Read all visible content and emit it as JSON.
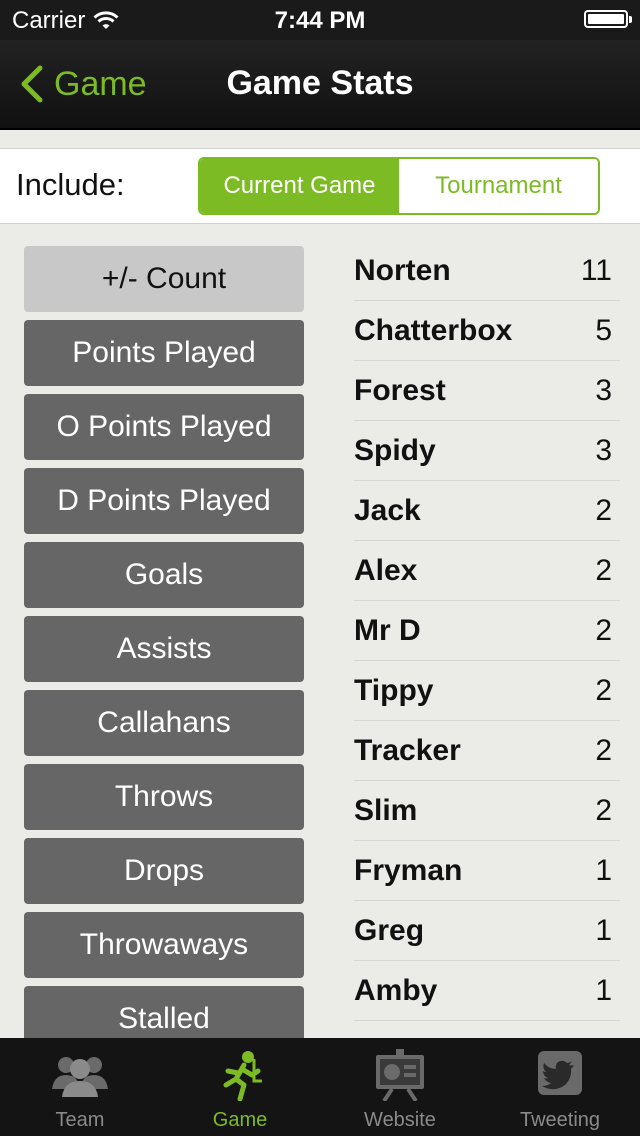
{
  "status": {
    "carrier": "Carrier",
    "time": "7:44 PM"
  },
  "nav": {
    "back_label": "Game",
    "title": "Game Stats"
  },
  "include": {
    "label": "Include:",
    "options": [
      "Current Game",
      "Tournament"
    ],
    "selected": "Current Game"
  },
  "stat_buttons": [
    "+/- Count",
    "Points Played",
    "O Points Played",
    "D Points Played",
    "Goals",
    "Assists",
    "Callahans",
    "Throws",
    "Drops",
    "Throwaways",
    "Stalled"
  ],
  "selected_stat": "+/- Count",
  "players": [
    {
      "name": "Norten",
      "count": "11"
    },
    {
      "name": "Chatterbox",
      "count": "5"
    },
    {
      "name": "Forest",
      "count": "3"
    },
    {
      "name": "Spidy",
      "count": "3"
    },
    {
      "name": "Jack",
      "count": "2"
    },
    {
      "name": "Alex",
      "count": "2"
    },
    {
      "name": "Mr D",
      "count": "2"
    },
    {
      "name": "Tippy",
      "count": "2"
    },
    {
      "name": "Tracker",
      "count": "2"
    },
    {
      "name": "Slim",
      "count": "2"
    },
    {
      "name": "Fryman",
      "count": "1"
    },
    {
      "name": "Greg",
      "count": "1"
    },
    {
      "name": "Amby",
      "count": "1"
    }
  ],
  "tabs": [
    {
      "label": "Team",
      "icon": "team-icon"
    },
    {
      "label": "Game",
      "icon": "runner-icon"
    },
    {
      "label": "Website",
      "icon": "presentation-icon"
    },
    {
      "label": "Tweeting",
      "icon": "twitter-icon"
    }
  ],
  "active_tab": "Game",
  "colors": {
    "accent": "#7dbb25",
    "button": "#666666",
    "button_selected": "#c8c8c8"
  }
}
